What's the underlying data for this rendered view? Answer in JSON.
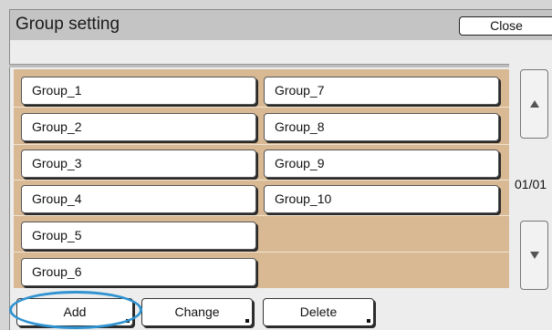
{
  "header": {
    "title": "Group setting",
    "close_label": "Close"
  },
  "groups": {
    "left": [
      "Group_1",
      "Group_2",
      "Group_3",
      "Group_4",
      "Group_5",
      "Group_6"
    ],
    "right": [
      "Group_7",
      "Group_8",
      "Group_9",
      "Group_10"
    ]
  },
  "pagination": {
    "indicator": "01/01"
  },
  "actions": {
    "add": "Add",
    "change": "Change",
    "delete": "Delete"
  },
  "colors": {
    "list_background": "#d8b994",
    "highlight_ring": "#2f93d1"
  }
}
